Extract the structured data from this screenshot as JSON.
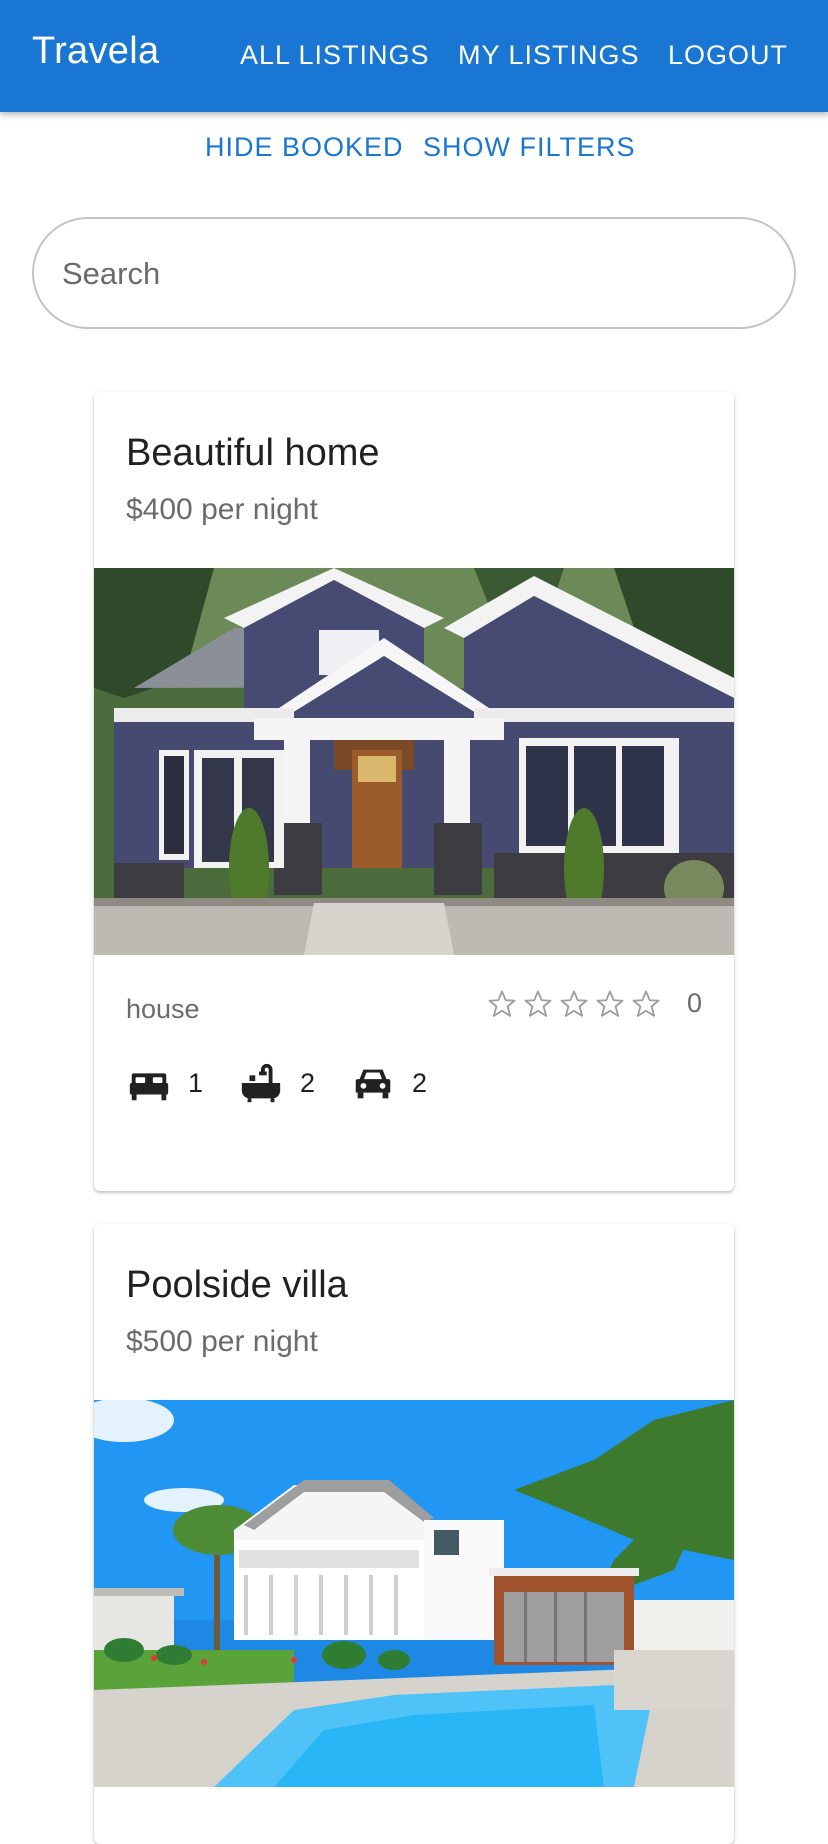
{
  "app": {
    "brand": "Travela",
    "accent_color": "#1976d2"
  },
  "nav": {
    "all_listings": "ALL LISTINGS",
    "my_listings": "MY LISTINGS",
    "logout": "LOGOUT"
  },
  "actions": {
    "hide_booked": "HIDE BOOKED",
    "show_filters": "SHOW FILTERS"
  },
  "search": {
    "placeholder": "Search",
    "value": ""
  },
  "listings": [
    {
      "title": "Beautiful home",
      "price": "$400 per night",
      "image_icon": "house-photo",
      "type": "house",
      "rating_stars": 0,
      "rating_count": "0",
      "beds": "1",
      "baths": "2",
      "parking": "2"
    },
    {
      "title": "Poolside villa",
      "price": "$500 per night",
      "image_icon": "villa-pool-photo"
    }
  ]
}
